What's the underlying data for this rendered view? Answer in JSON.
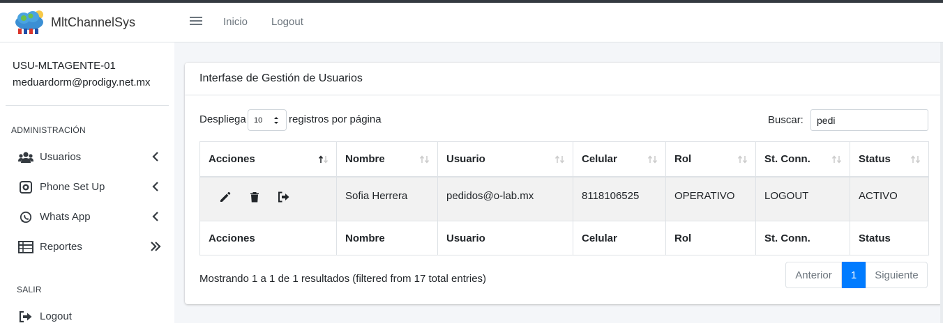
{
  "brand": {
    "name": "MltChannelSys",
    "logo": "cloud-logo-icon"
  },
  "topnav": {
    "menu_icon": "hamburger-icon",
    "links": [
      "Inicio",
      "Logout"
    ]
  },
  "sidebar": {
    "user_code": "USU-MLTAGENTE-01",
    "user_email": "meduardorm@prodigy.net.mx",
    "section_admin": "ADMINISTRACIÓN",
    "items": [
      {
        "label": "Usuarios",
        "icon": "users-icon",
        "chevron": "chevron-left-icon"
      },
      {
        "label": "Phone Set Up",
        "icon": "phone-setup-icon",
        "chevron": "chevron-left-icon"
      },
      {
        "label": "Whats App",
        "icon": "whatsapp-icon",
        "chevron": "chevron-left-icon"
      },
      {
        "label": "Reportes",
        "icon": "table-icon",
        "chevron": "double-chevron-right-icon"
      }
    ],
    "section_exit": "SALIR",
    "logout": {
      "label": "Logout",
      "icon": "sign-out-icon"
    }
  },
  "card": {
    "title": "Interfase de Gestión de Usuarios",
    "length": {
      "prefix": "Despliega",
      "value": "10",
      "suffix": "registros por página"
    },
    "search": {
      "label": "Buscar:",
      "value": "pedi"
    },
    "columns": [
      "Acciones",
      "Nombre",
      "Usuario",
      "Celular",
      "Rol",
      "St. Conn.",
      "Status"
    ],
    "rows": [
      {
        "actions": [
          "edit-icon",
          "trash-icon",
          "sign-out-icon"
        ],
        "nombre": "Sofia Herrera",
        "usuario": "pedidos@o-lab.mx",
        "celular": "8118106525",
        "rol": "OPERATIVO",
        "st_conn": "LOGOUT",
        "status": "ACTIVO"
      }
    ],
    "info": "Mostrando 1 a 1 de 1 resultados (filtered from 17 total entries)",
    "pagination": {
      "prev": "Anterior",
      "current": "1",
      "next": "Siguiente"
    }
  },
  "colors": {
    "primary": "#007bff",
    "background": "#f4f6f9",
    "dark": "#343a40"
  }
}
